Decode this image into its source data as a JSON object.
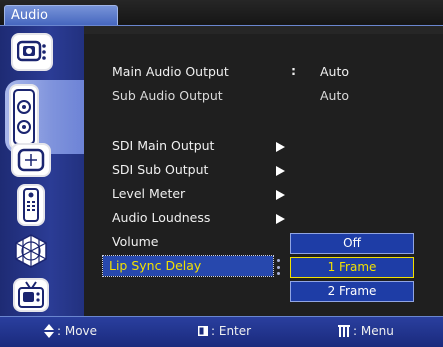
{
  "window": {
    "title": "Audio"
  },
  "sidebar": {
    "items": [
      {
        "icon": "video-settings-icon",
        "selected": false
      },
      {
        "icon": "audio-speaker-icon",
        "selected": true
      },
      {
        "icon": "display-crosshair-icon",
        "selected": false
      },
      {
        "icon": "remote-control-icon",
        "selected": false
      },
      {
        "icon": "network-globe-icon",
        "selected": false
      },
      {
        "icon": "tv-setup-icon",
        "selected": false
      }
    ]
  },
  "menu": {
    "items": [
      {
        "label": "Main Audio Output",
        "separator": ":",
        "value": "Auto"
      },
      {
        "label": "Sub Audio Output",
        "value": "Auto"
      },
      {
        "label": "SDI Main Output",
        "has_submenu": true
      },
      {
        "label": "SDI Sub Output",
        "has_submenu": true
      },
      {
        "label": "Level Meter",
        "has_submenu": true
      },
      {
        "label": "Audio Loudness",
        "has_submenu": true
      },
      {
        "label": "Volume",
        "separator": ":"
      },
      {
        "label": "Lip Sync Delay",
        "selected": true
      }
    ]
  },
  "dropdown": {
    "options": [
      "Off",
      "1 Frame",
      "2 Frame"
    ],
    "selected": "1 Frame"
  },
  "bottom_bar": {
    "move_label": ": Move",
    "enter_label": ": Enter",
    "menu_label": ": Menu"
  },
  "colors": {
    "sidebar": "#2b3c95",
    "highlight": "#2748ad",
    "selected_text": "#f2e100",
    "bottom_bar": "#22338c"
  }
}
